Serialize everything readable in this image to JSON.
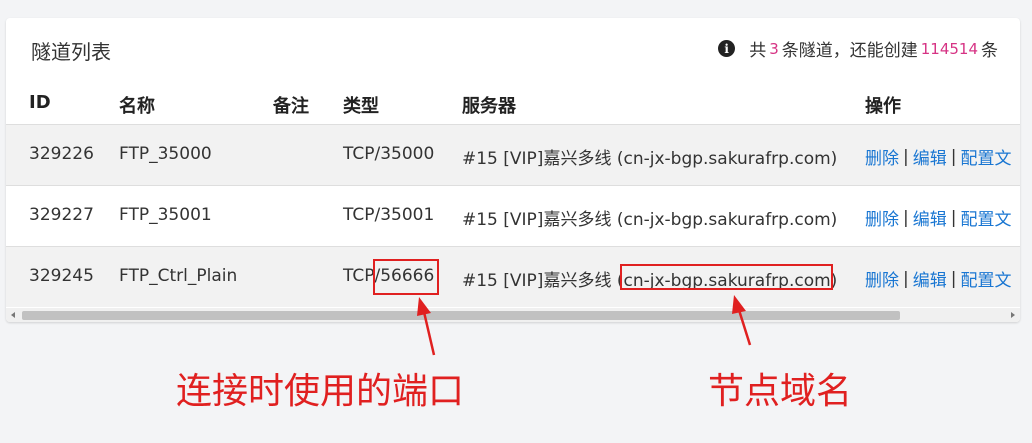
{
  "card": {
    "title": "隧道列表",
    "summary": {
      "prefix": "共",
      "count": "3",
      "middle": "条隧道，还能创建",
      "remaining": "114514",
      "suffix": "条"
    }
  },
  "table": {
    "headers": [
      "ID",
      "名称",
      "备注",
      "类型",
      "服务器",
      "操作"
    ],
    "rows": [
      {
        "id": "329226",
        "name": "FTP_35000",
        "note": "",
        "type": "TCP/35000",
        "server": "#15 [VIP]嘉兴多线 (cn-jx-bgp.sakurafrp.com)"
      },
      {
        "id": "329227",
        "name": "FTP_35001",
        "note": "",
        "type": "TCP/35001",
        "server": "#15 [VIP]嘉兴多线 (cn-jx-bgp.sakurafrp.com)"
      },
      {
        "id": "329245",
        "name": "FTP_Ctrl_Plain",
        "note": "",
        "type": "TCP/56666",
        "server": "#15 [VIP]嘉兴多线 (cn-jx-bgp.sakurafrp.com)"
      }
    ],
    "actions": {
      "delete": "删除",
      "edit": "编辑",
      "config": "配置文",
      "separator": "|"
    }
  },
  "annotations": {
    "port_label": "连接时使用的端口",
    "node_label": "节点域名",
    "color": "#e02020"
  },
  "colors": {
    "link": "#1976d2",
    "highlight_number": "#d63384",
    "stripe": "#f2f2f2"
  }
}
